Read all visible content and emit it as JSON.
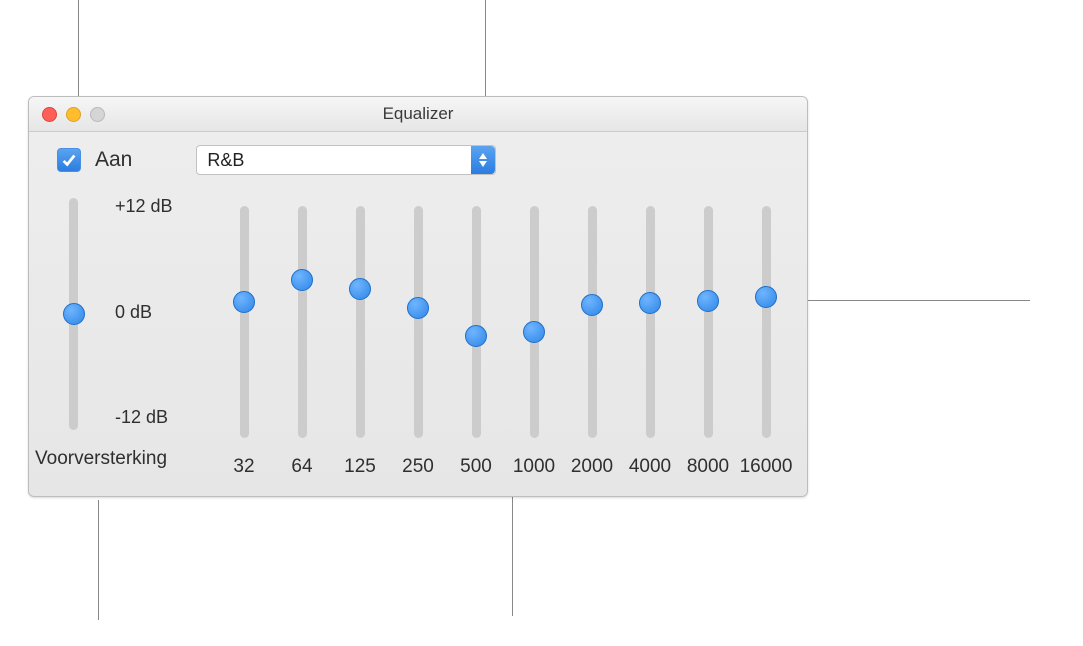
{
  "window": {
    "title": "Equalizer"
  },
  "toggle": {
    "checked": true,
    "label": "Aan"
  },
  "preset": {
    "value": "R&B"
  },
  "scale": {
    "top": "+12 dB",
    "mid": "0 dB",
    "bot": "-12 dB"
  },
  "preamp": {
    "label": "Voorversterking",
    "value": 0
  },
  "bands": [
    {
      "hz": "32",
      "value": 2.1
    },
    {
      "hz": "64",
      "value": 4.3
    },
    {
      "hz": "125",
      "value": 3.4
    },
    {
      "hz": "250",
      "value": 1.4
    },
    {
      "hz": "500",
      "value": -1.4
    },
    {
      "hz": "1000",
      "value": -1.0
    },
    {
      "hz": "2000",
      "value": 1.8
    },
    {
      "hz": "4000",
      "value": 2.0
    },
    {
      "hz": "8000",
      "value": 2.2
    },
    {
      "hz": "16000",
      "value": 2.6
    }
  ],
  "range": {
    "min": -12,
    "max": 12
  }
}
